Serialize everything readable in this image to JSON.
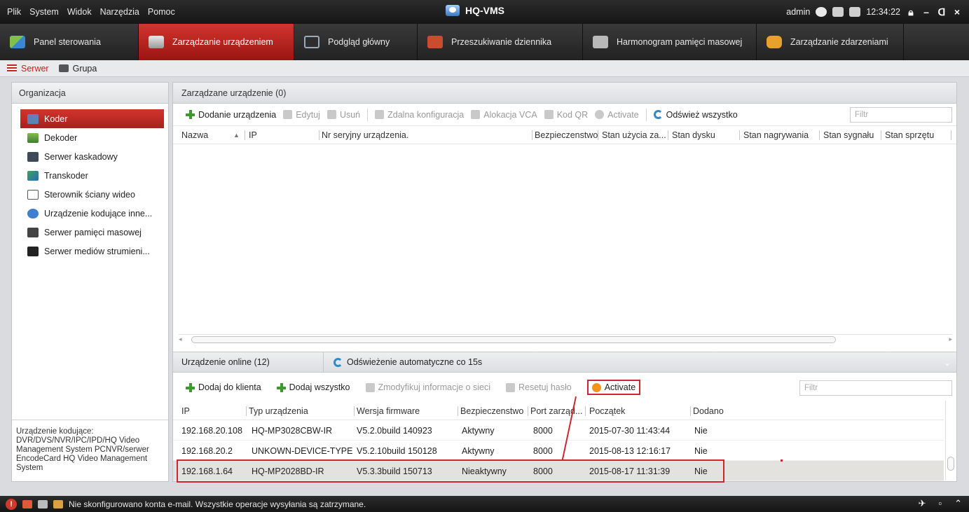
{
  "menu": [
    "Plik",
    "System",
    "Widok",
    "Narzędzia",
    "Pomoc"
  ],
  "app_title": "HQ-VMS",
  "user": "admin",
  "clock": "12:34:22",
  "window_buttons": {
    "minimize": "–",
    "restore": "ᗡ",
    "close": "×"
  },
  "modules": [
    {
      "label": "Panel sterowania",
      "icon": "control-panel-icon"
    },
    {
      "label": "Zarządzanie urządzeniem",
      "icon": "device-management-icon",
      "active": true
    },
    {
      "label": "Podgląd główny",
      "icon": "main-view-icon"
    },
    {
      "label": "Przeszukiwanie dziennika",
      "icon": "log-search-icon"
    },
    {
      "label": "Harmonogram pamięci masowej",
      "icon": "storage-schedule-icon"
    },
    {
      "label": "Zarządzanie zdarzeniami",
      "icon": "event-management-icon"
    }
  ],
  "subtabs": [
    {
      "label": "Serwer",
      "active": true
    },
    {
      "label": "Grupa"
    }
  ],
  "organization": {
    "title": "Organizacja",
    "items": [
      {
        "label": "Koder",
        "active": true
      },
      {
        "label": "Dekoder"
      },
      {
        "label": "Serwer kaskadowy"
      },
      {
        "label": "Transkoder"
      },
      {
        "label": "Sterownik ściany wideo"
      },
      {
        "label": "Urządzenie kodujące inne..."
      },
      {
        "label": "Serwer pamięci masowej"
      },
      {
        "label": "Serwer mediów strumieni..."
      }
    ],
    "description": "Urządzenie kodujące: DVR/DVS/NVR/IPC/IPD/HQ Video Management System PCNVR/serwer EncodeCard HQ Video Management System"
  },
  "managed": {
    "title": "Zarządzane urządzenie (0)",
    "toolbar": {
      "add": "Dodanie urządzenia",
      "edit": "Edytuj",
      "delete": "Usuń",
      "remote_config": "Zdalna konfiguracja",
      "vca": "Alokacja VCA",
      "qr": "Kod QR",
      "activate": "Activate",
      "refresh_all": "Odśwież wszystko",
      "filter_placeholder": "Filtr"
    },
    "columns": [
      "Nazwa",
      "IP",
      "Nr seryjny urządzenia.",
      "Bezpieczenstwo",
      "Stan użycia za...",
      "Stan dysku",
      "Stan nagrywania",
      "Stan sygnału",
      "Stan sprzętu"
    ],
    "sort_indicator": "▲"
  },
  "online": {
    "title": "Urządzenie online (12)",
    "auto_refresh": "Odświeżenie automatyczne co 15s",
    "toolbar": {
      "add_to_client": "Dodaj do klienta",
      "add_all": "Dodaj wszystko",
      "modify_network": "Zmodyfikuj informacje o sieci",
      "reset_password": "Resetuj hasło",
      "activate": "Activate",
      "filter_placeholder": "Filtr"
    },
    "columns": [
      "IP",
      "Typ urządzenia",
      "Wersja firmware",
      "Bezpieczenstwo",
      "Port zarząd...",
      "Początek",
      "Dodano"
    ],
    "rows": [
      [
        "192.168.20.108",
        "HQ-MP3028CBW-IR",
        "V5.2.0build 140923",
        "Aktywny",
        "8000",
        "2015-07-30 11:43:44",
        "Nie"
      ],
      [
        "192.168.20.2",
        "UNKOWN-DEVICE-TYPE",
        "V5.2.10build 150128",
        "Aktywny",
        "8000",
        "2015-08-13 12:16:17",
        "Nie"
      ],
      [
        "192.168.1.64",
        "HQ-MP2028BD-IR",
        "V5.3.3build 150713",
        "Nieaktywny",
        "8000",
        "2015-08-17 11:31:39",
        "Nie"
      ]
    ],
    "selected_row": 2
  },
  "status": {
    "alert_icon": "!",
    "message": "Nie skonfigurowano konta e-mail. Wszystkie operacje wysyłania są zatrzymane."
  },
  "colors": {
    "accent": "#c3231d",
    "highlight_box": "#c8282f"
  }
}
